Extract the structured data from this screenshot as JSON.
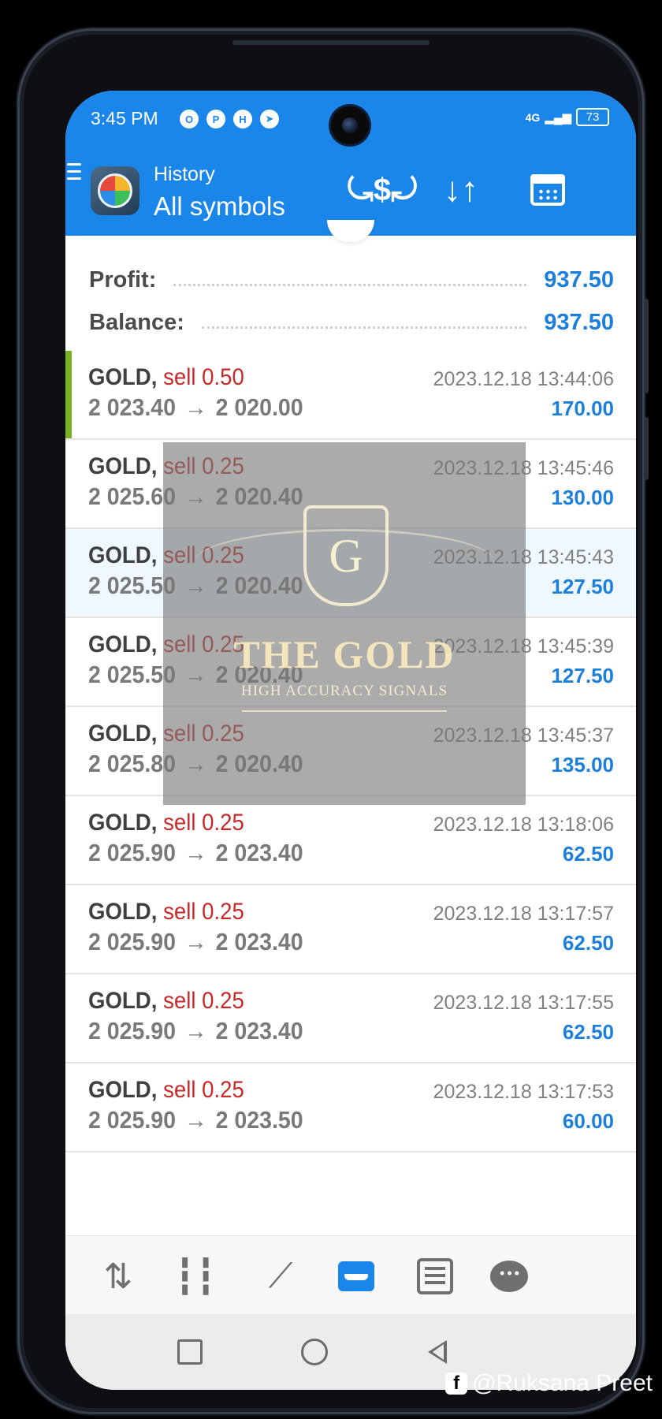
{
  "status": {
    "time": "3:45 PM",
    "icons": [
      "O",
      "P",
      "H",
      "➤"
    ],
    "network": "4G",
    "battery": "73"
  },
  "header": {
    "subtitle": "History",
    "title": "All symbols",
    "icons": [
      "menu-icon",
      "app-logo",
      "balance-operations-icon",
      "sort-icon",
      "calendar-icon"
    ]
  },
  "summary": {
    "profit_label": "Profit:",
    "profit_value": "937.50",
    "balance_label": "Balance:",
    "balance_value": "937.50"
  },
  "deals": [
    {
      "symbol": "GOLD,",
      "type": "sell 0.50",
      "open": "2 023.40",
      "arrow": "→",
      "close": "2 020.00",
      "time": "2023.12.18 13:44:06",
      "profit": "170.00"
    },
    {
      "symbol": "GOLD,",
      "type": "sell 0.25",
      "open": "2 025.60",
      "arrow": "→",
      "close": "2 020.40",
      "time": "2023.12.18 13:45:46",
      "profit": "130.00"
    },
    {
      "symbol": "GOLD,",
      "type": "sell 0.25",
      "open": "2 025.50",
      "arrow": "→",
      "close": "2 020.40",
      "time": "2023.12.18 13:45:43",
      "profit": "127.50"
    },
    {
      "symbol": "GOLD,",
      "type": "sell 0.25",
      "open": "2 025.50",
      "arrow": "→",
      "close": "2 020.40",
      "time": "2023.12.18 13:45:39",
      "profit": "127.50"
    },
    {
      "symbol": "GOLD,",
      "type": "sell 0.25",
      "open": "2 025.80",
      "arrow": "→",
      "close": "2 020.40",
      "time": "2023.12.18 13:45:37",
      "profit": "135.00"
    },
    {
      "symbol": "GOLD,",
      "type": "sell 0.25",
      "open": "2 025.90",
      "arrow": "→",
      "close": "2 023.40",
      "time": "2023.12.18 13:18:06",
      "profit": "62.50"
    },
    {
      "symbol": "GOLD,",
      "type": "sell 0.25",
      "open": "2 025.90",
      "arrow": "→",
      "close": "2 023.40",
      "time": "2023.12.18 13:17:57",
      "profit": "62.50"
    },
    {
      "symbol": "GOLD,",
      "type": "sell 0.25",
      "open": "2 025.90",
      "arrow": "→",
      "close": "2 023.40",
      "time": "2023.12.18 13:17:55",
      "profit": "62.50"
    },
    {
      "symbol": "GOLD,",
      "type": "sell 0.25",
      "open": "2 025.90",
      "arrow": "→",
      "close": "2 023.50",
      "time": "2023.12.18 13:17:53",
      "profit": "60.00"
    }
  ],
  "watermark": {
    "letter": "G",
    "title": "THE GOLD",
    "subtitle": "HIGH ACCURACY SIGNALS"
  },
  "bottom_nav": {
    "items": [
      "quotes-icon",
      "chart-icon",
      "trade-icon",
      "history-icon",
      "news-icon",
      "messages-icon"
    ],
    "active": "history-icon"
  },
  "credit": {
    "handle": "@Ruksana Preet"
  },
  "colors": {
    "appbar": "#1b86ea",
    "sell": "#c62a2a",
    "profit": "#1c7fdc",
    "first_marker": "#79b321"
  }
}
